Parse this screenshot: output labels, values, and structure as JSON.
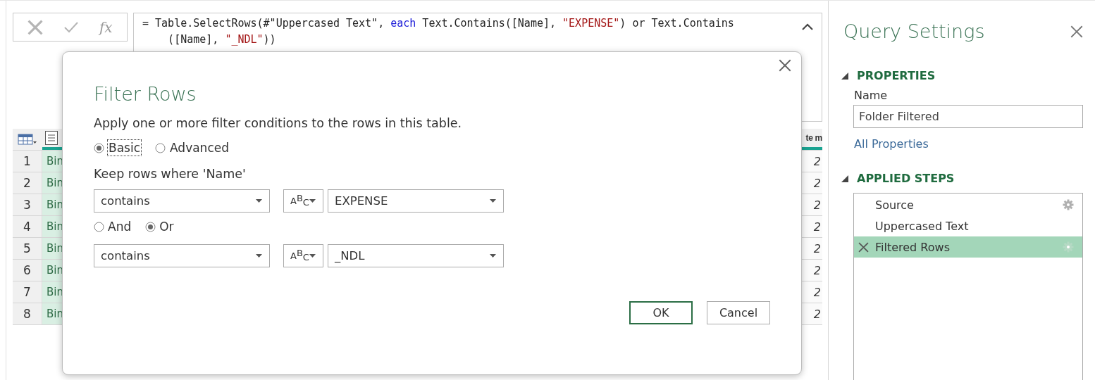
{
  "formula_bar": {
    "fx_label": "fx",
    "lines": [
      [
        {
          "kind": "plain",
          "text": "= Table.SelectRows(#\"Uppercased Text\", "
        },
        {
          "kind": "keyword",
          "text": "each"
        },
        {
          "kind": "plain",
          "text": " Text.Contains([Name], "
        },
        {
          "kind": "string",
          "text": "\"EXPENSE\""
        },
        {
          "kind": "plain",
          "text": ") or Text.Contains"
        }
      ],
      [
        {
          "kind": "plain",
          "text": "    ([Name], "
        },
        {
          "kind": "string",
          "text": "\"_NDL\""
        },
        {
          "kind": "plain",
          "text": "))"
        }
      ]
    ],
    "expanded": true
  },
  "table": {
    "last_column_header": "te m",
    "rows": [
      {
        "number": "1",
        "column_1": "Bin",
        "column_last": "2"
      },
      {
        "number": "2",
        "column_1": "Bin",
        "column_last": "2"
      },
      {
        "number": "3",
        "column_1": "Bin",
        "column_last": "2"
      },
      {
        "number": "4",
        "column_1": "Bin",
        "column_last": "2"
      },
      {
        "number": "5",
        "column_1": "Bin",
        "column_last": "2"
      },
      {
        "number": "6",
        "column_1": "Bin",
        "column_last": "2"
      },
      {
        "number": "7",
        "column_1": "Bin",
        "column_last": "2"
      },
      {
        "number": "8",
        "column_1": "Bin",
        "column_last": "2"
      }
    ]
  },
  "dialog": {
    "title": "Filter Rows",
    "description": "Apply one or more filter conditions to the rows in this table.",
    "modes": [
      {
        "label": "Basic",
        "selected": true,
        "focused": true
      },
      {
        "label": "Advanced",
        "selected": false,
        "focused": false
      }
    ],
    "keep_label": "Keep rows where 'Name'",
    "conditions": [
      {
        "operator": "contains",
        "type_glyph": "ABC",
        "value": "EXPENSE"
      },
      {
        "operator": "contains",
        "type_glyph": "ABC",
        "value": "_NDL"
      }
    ],
    "joiners": [
      {
        "label": "And",
        "selected": false
      },
      {
        "label": "Or",
        "selected": true
      }
    ],
    "buttons": [
      {
        "label": "OK",
        "kind": "primary"
      },
      {
        "label": "Cancel",
        "kind": "secondary"
      }
    ]
  },
  "query_settings": {
    "title": "Query Settings",
    "properties": {
      "heading": "PROPERTIES",
      "expanded": true,
      "name_label": "Name",
      "name_value": "Folder Filtered",
      "link": "All Properties"
    },
    "applied_steps": {
      "heading": "APPLIED STEPS",
      "expanded": true,
      "steps": [
        {
          "label": "Source",
          "selected": false,
          "has_settings": true
        },
        {
          "label": "Uppercased Text",
          "selected": false,
          "has_settings": false
        },
        {
          "label": "Filtered Rows",
          "selected": true,
          "has_settings": true
        }
      ]
    }
  }
}
